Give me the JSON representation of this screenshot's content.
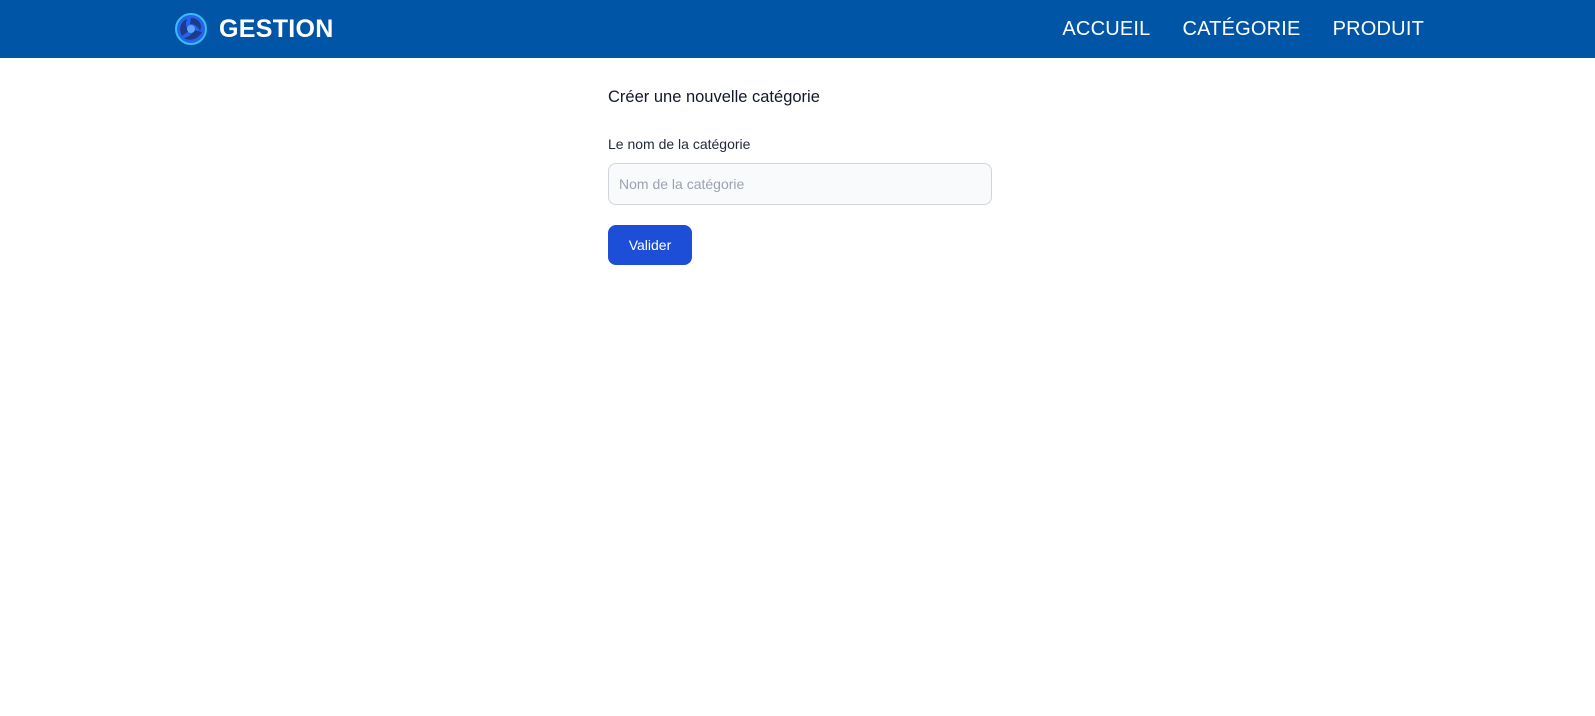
{
  "navbar": {
    "brand_name": "GESTION",
    "logo_icon": "swirl-logo-icon",
    "background_color": "#0055a6",
    "links": [
      {
        "label": "ACCUEIL"
      },
      {
        "label": "CATÉGORIE"
      },
      {
        "label": "PRODUIT"
      }
    ]
  },
  "form": {
    "title": "Créer une nouvelle catégorie",
    "name_label": "Le nom de la catégorie",
    "name_value": "",
    "name_placeholder": "Nom de la catégorie",
    "submit_label": "Valider",
    "submit_color": "#1d4ed8"
  }
}
